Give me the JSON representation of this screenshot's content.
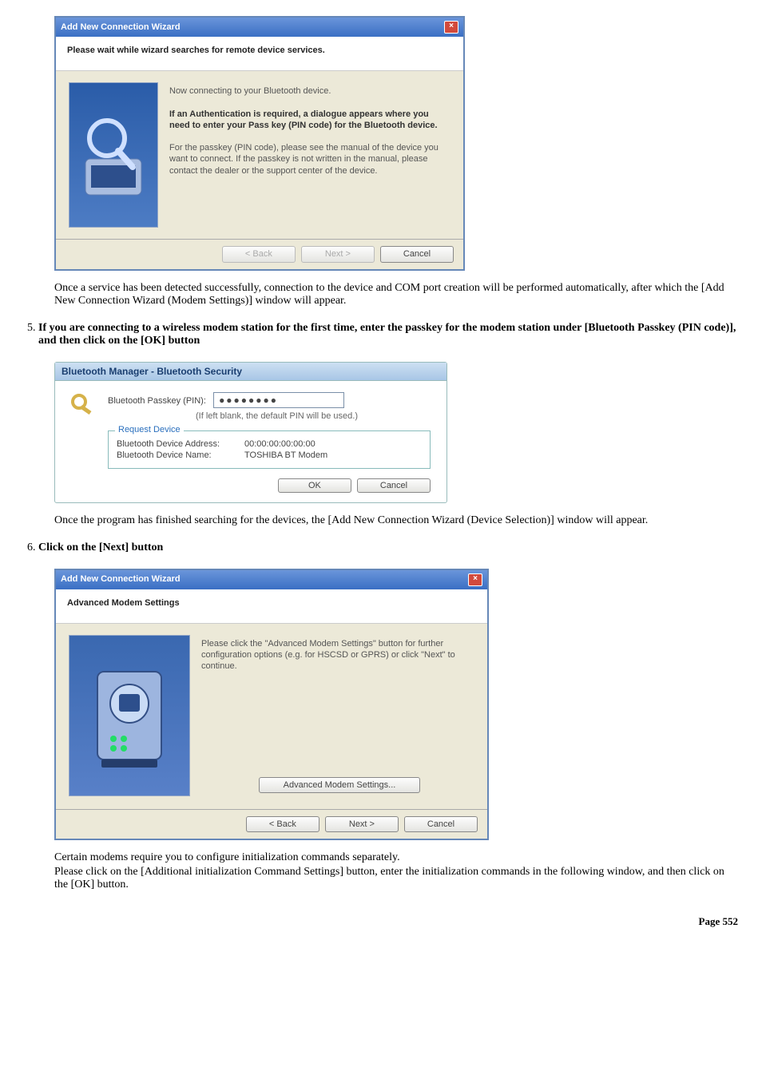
{
  "dlg1": {
    "title": "Add New Connection Wizard",
    "header": "Please wait while wizard searches for remote device services.",
    "line1": "Now connecting to your Bluetooth device.",
    "bold1": "If an Authentication is required, a dialogue appears where you need to enter your Pass key (PIN code) for the Bluetooth device.",
    "line2": "For the passkey (PIN code), please see the manual of the device you want to connect. If the passkey is not written in the manual, please contact the dealer or the support center of the device.",
    "back": "< Back",
    "next": "Next >",
    "cancel": "Cancel"
  },
  "para1": "Once a service has been detected successfully, connection to the device and COM port creation will be performed automatically, after which the [Add New Connection Wizard (Modem Settings)] window will appear.",
  "step5": "If you are connecting to a wireless modem station for the first time, enter the passkey for the modem station under [Bluetooth Passkey (PIN code)], and then click on the [OK] button",
  "bt": {
    "title": "Bluetooth Manager - Bluetooth Security",
    "pinlabel": "Bluetooth Passkey (PIN):",
    "pinmask": "●●●●●●●●",
    "hint": "(If left blank, the default PIN will be used.)",
    "legend": "Request Device",
    "addr_k": "Bluetooth Device Address:",
    "addr_v": "00:00:00:00:00:00",
    "name_k": "Bluetooth Device Name:",
    "name_v": "TOSHIBA BT Modem",
    "ok": "OK",
    "cancel": "Cancel"
  },
  "para2": "Once the program has finished searching for the devices, the [Add New Connection Wizard (Device Selection)] window will appear.",
  "step6": "Click on the [Next] button",
  "dlg3": {
    "title": "Add New Connection Wizard",
    "header": "Advanced Modem Settings",
    "txt": "Please click the \"Advanced Modem Settings\" button for further configuration options (e.g. for HSCSD or GPRS) or click \"Next\" to continue.",
    "adv": "Advanced Modem Settings...",
    "back": "< Back",
    "next": "Next >",
    "cancel": "Cancel"
  },
  "para3a": "Certain modems require you to configure initialization commands separately.",
  "para3b": "Please click on the [Additional initialization Command Settings] button, enter the initialization commands in the following window, and then click on the [OK] button.",
  "pagenum": "Page 552"
}
